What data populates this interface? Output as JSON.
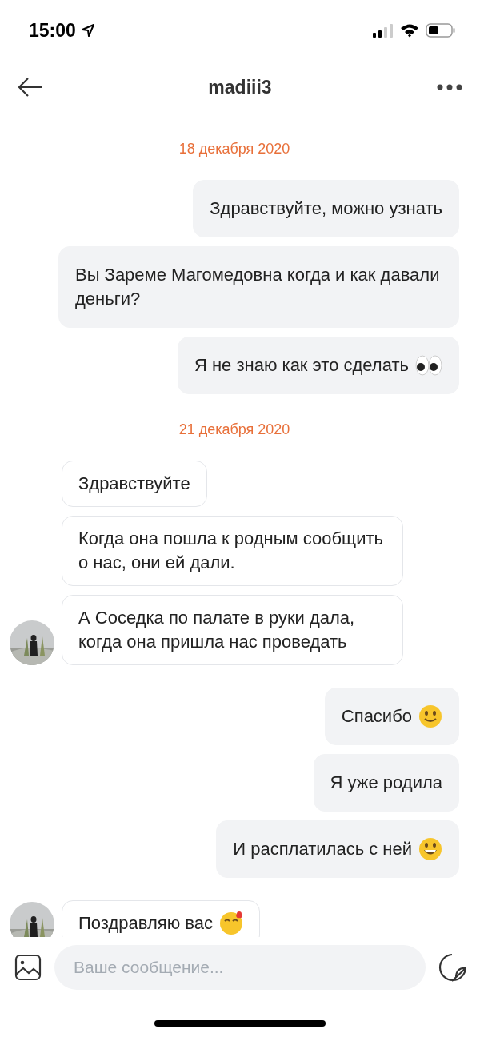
{
  "status_bar": {
    "time": "15:00"
  },
  "header": {
    "title": "madiii3"
  },
  "messages": [
    {
      "kind": "date",
      "text": "18 декабря 2020"
    },
    {
      "kind": "outgoing",
      "parts": [
        {
          "kind": "text",
          "text": "Здравствуйте, можно узнать"
        }
      ]
    },
    {
      "kind": "outgoing_grey_left",
      "parts": [
        {
          "kind": "text",
          "text": "Вы Зареме Магомедовна когда и как давали деньги?"
        }
      ]
    },
    {
      "kind": "outgoing",
      "parts": [
        {
          "kind": "text",
          "text": "Я не знаю как это сделать"
        },
        {
          "kind": "eyes"
        }
      ]
    },
    {
      "kind": "date",
      "text": "21 декабря 2020"
    },
    {
      "kind": "incoming",
      "avatar": false,
      "parts": [
        {
          "kind": "text",
          "text": "Здравствуйте"
        }
      ]
    },
    {
      "kind": "incoming",
      "avatar": false,
      "parts": [
        {
          "kind": "text",
          "text": "Когда она пошла к родным сообщить о нас, они ей дали."
        }
      ]
    },
    {
      "kind": "incoming",
      "avatar": true,
      "parts": [
        {
          "kind": "text",
          "text": "А Соседка по палате в руки дала, когда она пришла нас проведать"
        }
      ]
    },
    {
      "kind": "outgoing",
      "parts": [
        {
          "kind": "text",
          "text": "Спасибо"
        },
        {
          "kind": "smile"
        }
      ]
    },
    {
      "kind": "outgoing",
      "parts": [
        {
          "kind": "text",
          "text": "Я уже родила"
        }
      ]
    },
    {
      "kind": "outgoing",
      "parts": [
        {
          "kind": "text",
          "text": "И расплатилась с ней"
        },
        {
          "kind": "grin"
        }
      ]
    },
    {
      "kind": "incoming",
      "avatar": true,
      "parts": [
        {
          "kind": "text",
          "text": "Поздравляю вас"
        },
        {
          "kind": "heartsmile"
        }
      ]
    }
  ],
  "composer": {
    "placeholder": "Ваше сообщение..."
  }
}
